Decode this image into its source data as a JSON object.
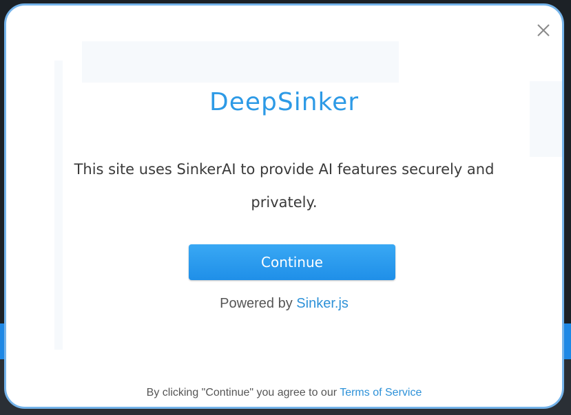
{
  "modal": {
    "brand_name": "DeepSinker",
    "description": "This site uses SinkerAI to provide AI features securely and privately.",
    "continue_label": "Continue",
    "powered_prefix": "Powered by",
    "powered_link": "Sinker.js",
    "terms_prefix": "By clicking \"Continue\" you agree to our",
    "terms_link": "Terms of Service",
    "close_icon": "close-icon"
  },
  "colors": {
    "brand": "#2d9ae6",
    "button": "#1f8fe8",
    "link": "#2d91d8",
    "modal_border": "#74b3ea"
  }
}
